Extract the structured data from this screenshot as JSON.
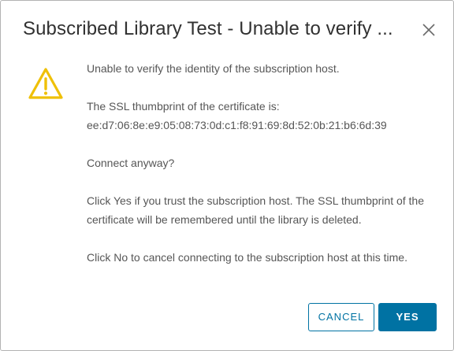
{
  "dialog": {
    "title": "Subscribed Library Test - Unable to verify ...",
    "close_icon": "close-icon",
    "warning_icon": "warning-triangle-icon",
    "accent_color": "#0072a3",
    "warning_color": "#efc006"
  },
  "message": {
    "line1": "Unable to verify the identity of the subscription host.",
    "thumbprint_label": "The SSL thumbprint of the certificate is:",
    "thumbprint_value": "ee:d7:06:8e:e9:05:08:73:0d:c1:f8:91:69:8d:52:0b:21:b6:6d:39",
    "question": "Connect anyway?",
    "yes_hint": "Click Yes if you trust the subscription host. The SSL thumbprint of the certificate will be remembered until the library is deleted.",
    "no_hint": "Click No to cancel connecting to the subscription host at this time."
  },
  "buttons": {
    "cancel_label": "CANCEL",
    "yes_label": "YES"
  }
}
